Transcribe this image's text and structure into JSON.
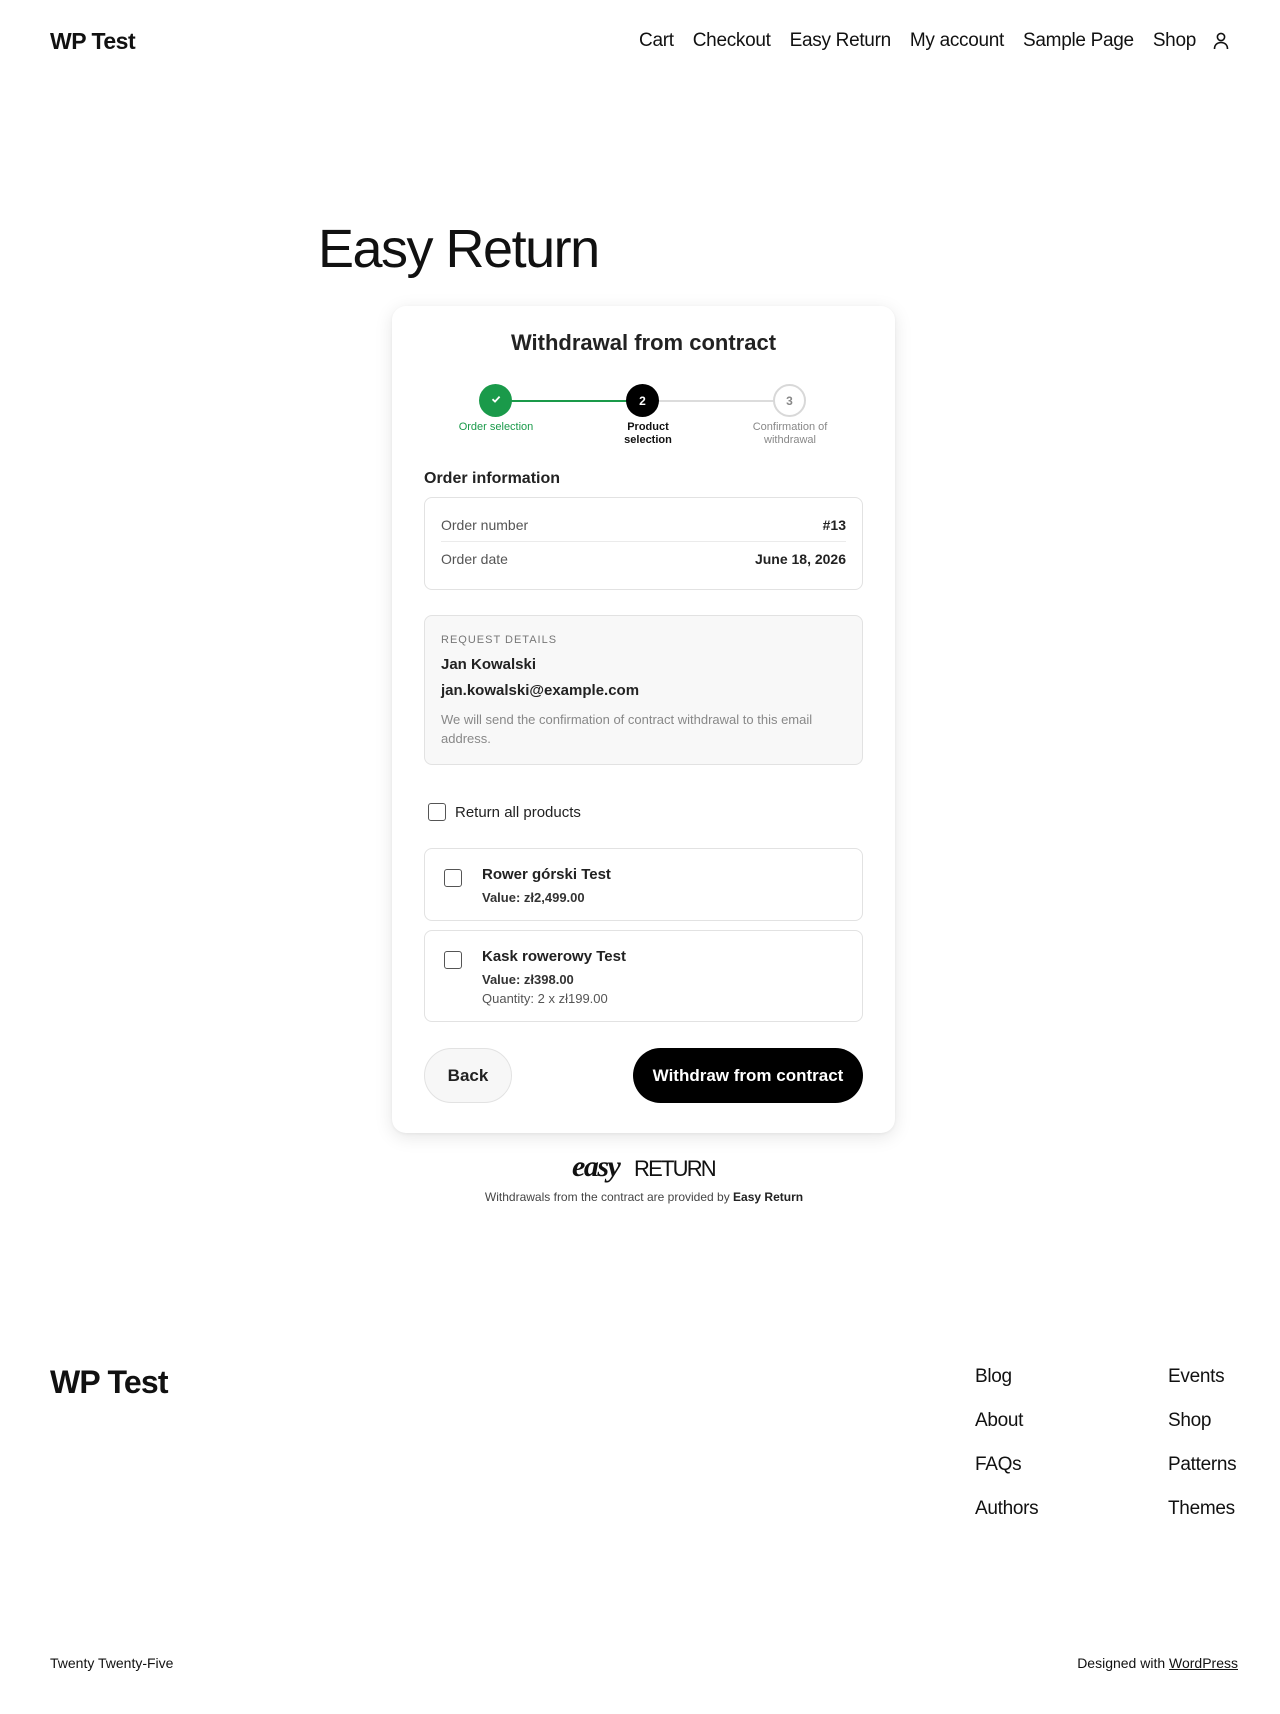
{
  "header": {
    "site_title": "WP Test",
    "nav": [
      "Cart",
      "Checkout",
      "Easy Return",
      "My account",
      "Sample Page",
      "Shop"
    ],
    "user_icon": "user-icon"
  },
  "page": {
    "title": "Easy Return"
  },
  "card": {
    "title": "Withdrawal from contract",
    "steps": [
      {
        "number": "1",
        "label": "Order selection",
        "state": "completed"
      },
      {
        "number": "2",
        "label": "Product selection",
        "state": "current"
      },
      {
        "number": "3",
        "label": "Confirmation of withdrawal",
        "state": "upcoming"
      }
    ],
    "order_info": {
      "heading": "Order information",
      "number_label": "Order number",
      "number_value": "#13",
      "date_label": "Order date",
      "date_value": "June 18, 2026"
    },
    "request": {
      "label": "REQUEST DETAILS",
      "name": "Jan Kowalski",
      "email": "jan.kowalski@example.com",
      "note": "We will send the confirmation of contract withdrawal to this email address."
    },
    "return_all_label": "Return all products",
    "products": [
      {
        "name": "Rower górski Test",
        "value": "Value: zł2,499.00",
        "checked": false
      },
      {
        "name": "Kask rowerowy Test",
        "value": "Value: zł398.00",
        "quantity": "Quantity: 2 x zł199.00",
        "checked": false
      }
    ],
    "back_label": "Back",
    "withdraw_label": "Withdraw from contract"
  },
  "brand": {
    "logo_left": "easy",
    "logo_right": "RETURN",
    "text_prefix": "Withdrawals from the contract are provided by",
    "text_brand": "Easy Return"
  },
  "footer": {
    "title": "WP Test",
    "col1": [
      "Blog",
      "About",
      "FAQs",
      "Authors"
    ],
    "col2": [
      "Events",
      "Shop",
      "Patterns",
      "Themes"
    ],
    "left_text": "Twenty Twenty-Five",
    "right_prefix": "Designed with",
    "right_link": "WordPress"
  },
  "colors": {
    "accent_green": "#1a9a4a",
    "primary_button": "#000000"
  }
}
